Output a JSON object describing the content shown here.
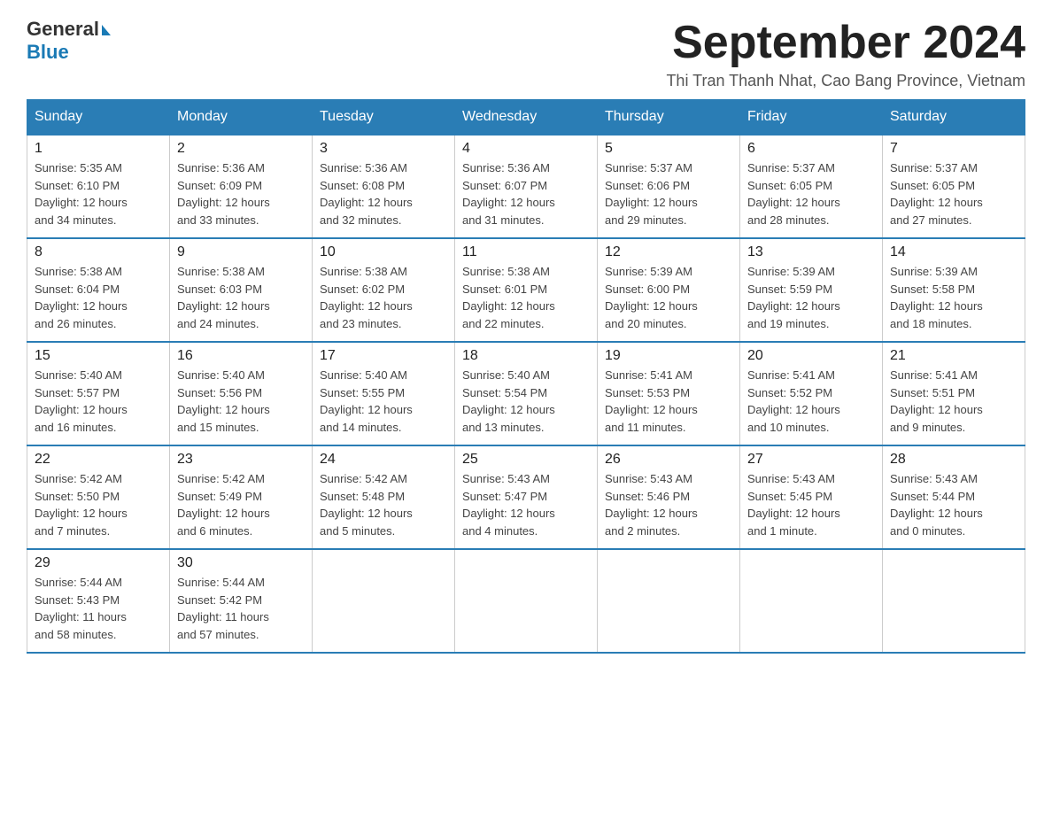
{
  "header": {
    "logo_general": "General",
    "logo_blue": "Blue",
    "month_title": "September 2024",
    "subtitle": "Thi Tran Thanh Nhat, Cao Bang Province, Vietnam"
  },
  "days_of_week": [
    "Sunday",
    "Monday",
    "Tuesday",
    "Wednesday",
    "Thursday",
    "Friday",
    "Saturday"
  ],
  "weeks": [
    [
      {
        "day": "1",
        "sunrise": "5:35 AM",
        "sunset": "6:10 PM",
        "daylight": "12 hours and 34 minutes."
      },
      {
        "day": "2",
        "sunrise": "5:36 AM",
        "sunset": "6:09 PM",
        "daylight": "12 hours and 33 minutes."
      },
      {
        "day": "3",
        "sunrise": "5:36 AM",
        "sunset": "6:08 PM",
        "daylight": "12 hours and 32 minutes."
      },
      {
        "day": "4",
        "sunrise": "5:36 AM",
        "sunset": "6:07 PM",
        "daylight": "12 hours and 31 minutes."
      },
      {
        "day": "5",
        "sunrise": "5:37 AM",
        "sunset": "6:06 PM",
        "daylight": "12 hours and 29 minutes."
      },
      {
        "day": "6",
        "sunrise": "5:37 AM",
        "sunset": "6:05 PM",
        "daylight": "12 hours and 28 minutes."
      },
      {
        "day": "7",
        "sunrise": "5:37 AM",
        "sunset": "6:05 PM",
        "daylight": "12 hours and 27 minutes."
      }
    ],
    [
      {
        "day": "8",
        "sunrise": "5:38 AM",
        "sunset": "6:04 PM",
        "daylight": "12 hours and 26 minutes."
      },
      {
        "day": "9",
        "sunrise": "5:38 AM",
        "sunset": "6:03 PM",
        "daylight": "12 hours and 24 minutes."
      },
      {
        "day": "10",
        "sunrise": "5:38 AM",
        "sunset": "6:02 PM",
        "daylight": "12 hours and 23 minutes."
      },
      {
        "day": "11",
        "sunrise": "5:38 AM",
        "sunset": "6:01 PM",
        "daylight": "12 hours and 22 minutes."
      },
      {
        "day": "12",
        "sunrise": "5:39 AM",
        "sunset": "6:00 PM",
        "daylight": "12 hours and 20 minutes."
      },
      {
        "day": "13",
        "sunrise": "5:39 AM",
        "sunset": "5:59 PM",
        "daylight": "12 hours and 19 minutes."
      },
      {
        "day": "14",
        "sunrise": "5:39 AM",
        "sunset": "5:58 PM",
        "daylight": "12 hours and 18 minutes."
      }
    ],
    [
      {
        "day": "15",
        "sunrise": "5:40 AM",
        "sunset": "5:57 PM",
        "daylight": "12 hours and 16 minutes."
      },
      {
        "day": "16",
        "sunrise": "5:40 AM",
        "sunset": "5:56 PM",
        "daylight": "12 hours and 15 minutes."
      },
      {
        "day": "17",
        "sunrise": "5:40 AM",
        "sunset": "5:55 PM",
        "daylight": "12 hours and 14 minutes."
      },
      {
        "day": "18",
        "sunrise": "5:40 AM",
        "sunset": "5:54 PM",
        "daylight": "12 hours and 13 minutes."
      },
      {
        "day": "19",
        "sunrise": "5:41 AM",
        "sunset": "5:53 PM",
        "daylight": "12 hours and 11 minutes."
      },
      {
        "day": "20",
        "sunrise": "5:41 AM",
        "sunset": "5:52 PM",
        "daylight": "12 hours and 10 minutes."
      },
      {
        "day": "21",
        "sunrise": "5:41 AM",
        "sunset": "5:51 PM",
        "daylight": "12 hours and 9 minutes."
      }
    ],
    [
      {
        "day": "22",
        "sunrise": "5:42 AM",
        "sunset": "5:50 PM",
        "daylight": "12 hours and 7 minutes."
      },
      {
        "day": "23",
        "sunrise": "5:42 AM",
        "sunset": "5:49 PM",
        "daylight": "12 hours and 6 minutes."
      },
      {
        "day": "24",
        "sunrise": "5:42 AM",
        "sunset": "5:48 PM",
        "daylight": "12 hours and 5 minutes."
      },
      {
        "day": "25",
        "sunrise": "5:43 AM",
        "sunset": "5:47 PM",
        "daylight": "12 hours and 4 minutes."
      },
      {
        "day": "26",
        "sunrise": "5:43 AM",
        "sunset": "5:46 PM",
        "daylight": "12 hours and 2 minutes."
      },
      {
        "day": "27",
        "sunrise": "5:43 AM",
        "sunset": "5:45 PM",
        "daylight": "12 hours and 1 minute."
      },
      {
        "day": "28",
        "sunrise": "5:43 AM",
        "sunset": "5:44 PM",
        "daylight": "12 hours and 0 minutes."
      }
    ],
    [
      {
        "day": "29",
        "sunrise": "5:44 AM",
        "sunset": "5:43 PM",
        "daylight": "11 hours and 58 minutes."
      },
      {
        "day": "30",
        "sunrise": "5:44 AM",
        "sunset": "5:42 PM",
        "daylight": "11 hours and 57 minutes."
      },
      null,
      null,
      null,
      null,
      null
    ]
  ],
  "labels": {
    "sunrise": "Sunrise:",
    "sunset": "Sunset:",
    "daylight": "Daylight:"
  }
}
